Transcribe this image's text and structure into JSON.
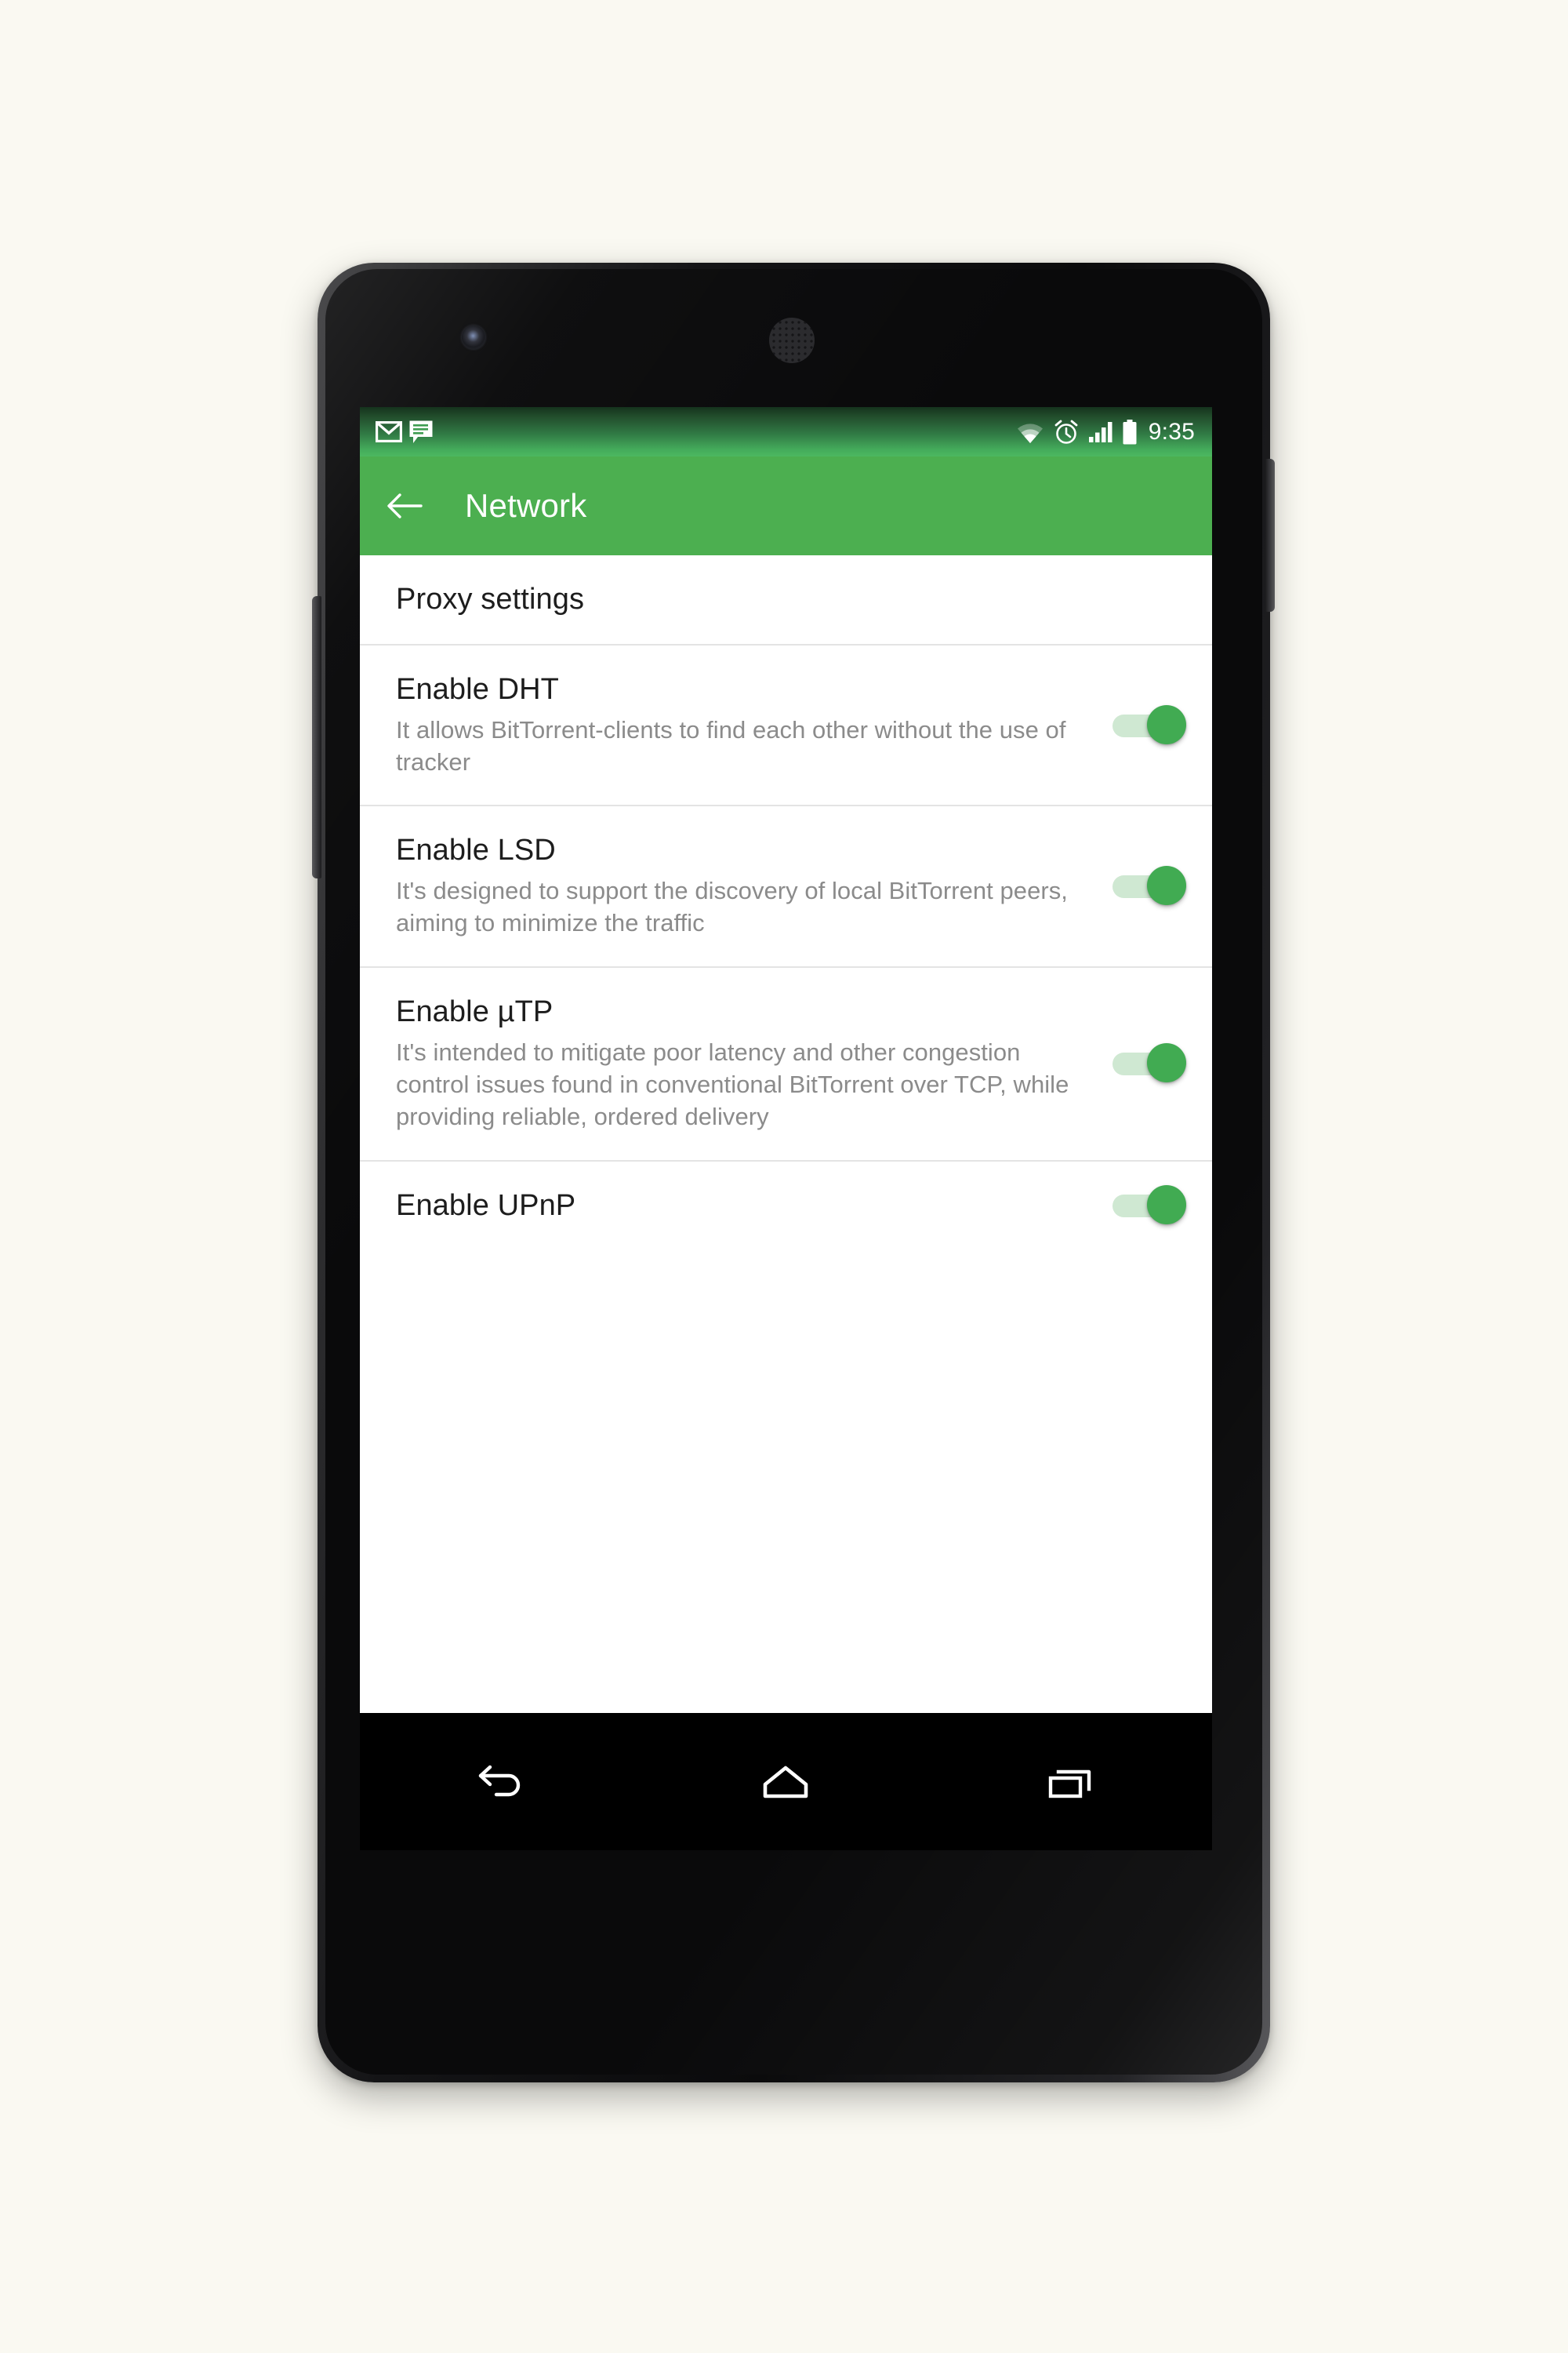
{
  "theme": {
    "page_background": "#faf9f2",
    "accent_green": "#4caf50",
    "status_bar_green_dark": "#15331d",
    "switch_track": "#cfe8d2",
    "switch_thumb": "#41ab52",
    "divider": "#e4e4e4",
    "title_text": "#1d1d1d",
    "summary_text": "#8b8b8b"
  },
  "device": {
    "name": "android-phone-mockup",
    "camera": "front-camera",
    "speaker": "earpiece-speaker",
    "volume_button": "volume-rocker",
    "power_button": "power-button"
  },
  "status_bar": {
    "notification_icons": [
      {
        "name": "gmail-icon",
        "label": "Gmail"
      },
      {
        "name": "messages-icon",
        "label": "Messages"
      }
    ],
    "system_icons": [
      {
        "name": "wifi-icon",
        "label": "Wi-Fi"
      },
      {
        "name": "alarm-icon",
        "label": "Alarm set"
      },
      {
        "name": "signal-icon",
        "label": "Cellular signal"
      },
      {
        "name": "battery-icon",
        "label": "Battery full"
      }
    ],
    "clock": "9:35"
  },
  "app_bar": {
    "back_label": "Navigate up",
    "title": "Network"
  },
  "settings": {
    "items": [
      {
        "key": "proxy_settings",
        "title": "Proxy settings",
        "summary": "",
        "has_switch": false
      },
      {
        "key": "enable_dht",
        "title": "Enable DHT",
        "summary": "It allows BitTorrent-clients to find each other without the use of tracker",
        "has_switch": true,
        "checked": true
      },
      {
        "key": "enable_lsd",
        "title": "Enable LSD",
        "summary": "It's designed to support the discovery of local BitTorrent peers, aiming to minimize the traffic",
        "has_switch": true,
        "checked": true
      },
      {
        "key": "enable_utp",
        "title": "Enable µTP",
        "summary": "It's intended to mitigate poor latency and other congestion control issues found in conventional BitTorrent over TCP, while providing reliable, ordered delivery",
        "has_switch": true,
        "checked": true
      },
      {
        "key": "enable_upnp",
        "title": "Enable UPnP",
        "summary": "",
        "has_switch": true,
        "checked": true
      }
    ]
  },
  "nav_bar": {
    "buttons": [
      {
        "name": "back-nav-icon",
        "label": "Back"
      },
      {
        "name": "home-nav-icon",
        "label": "Home"
      },
      {
        "name": "recents-nav-icon",
        "label": "Recent apps"
      }
    ]
  }
}
